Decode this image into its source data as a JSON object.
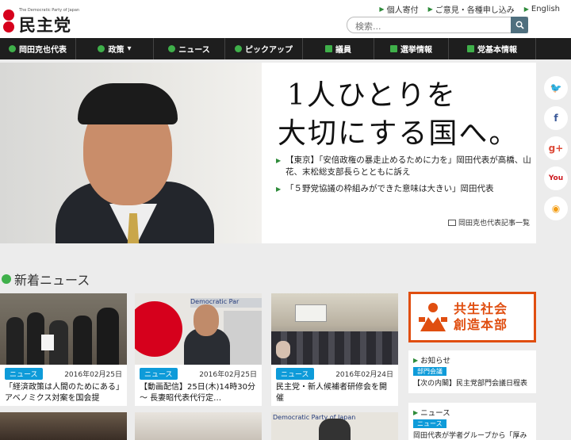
{
  "header": {
    "logo_sub": "The Democratic Party of Japan",
    "logo_name": "民主党",
    "links": [
      "個人寄付",
      "ご意見・各種申し込み",
      "English"
    ],
    "search_placeholder": "検索..."
  },
  "nav": {
    "items": [
      {
        "label": "岡田克也代表",
        "icon": "speech-icon"
      },
      {
        "label": "政策",
        "icon": "circle-icon",
        "dropdown": "▾"
      },
      {
        "label": "ニュース",
        "icon": "globe-icon"
      },
      {
        "label": "ピックアップ",
        "icon": "globe-icon"
      },
      {
        "label": "議員",
        "icon": "person-icon"
      },
      {
        "label": "選挙情報",
        "icon": "megaphone-icon"
      },
      {
        "label": "党基本情報",
        "icon": "briefcase-icon"
      }
    ]
  },
  "hero": {
    "copy_line1": "1人ひとりを",
    "copy_line2": "大切にする国へ。",
    "links": [
      "【東京】「安倍政権の暴走止めるために力を」岡田代表が高橋、山花、末松総支部長らとともに訴え",
      "「５野党協議の枠組みができた意味は大きい」岡田代表"
    ],
    "more_label": "岡田克也代表記事一覧"
  },
  "social": [
    "twitter-icon",
    "facebook-icon",
    "googleplus-icon",
    "youtube-icon",
    "rss-icon"
  ],
  "social_glyphs": [
    "🐦",
    "f",
    "g+",
    "You",
    "◉"
  ],
  "social_colors": [
    "#1da1f2",
    "#3b5998",
    "#dd4b39",
    "#cc181e",
    "#f39c12"
  ],
  "news": {
    "title": "新着ニュース",
    "cards": [
      {
        "badge": "ニュース",
        "date": "2016年02月25日",
        "title": "「経済政策は人間のためにある」アベノミクス対案を国会提"
      },
      {
        "badge": "ニュース",
        "date": "2016年02月25日",
        "title": "【動画配信】25日(木)14時30分～ 長妻昭代表代行定…"
      },
      {
        "badge": "ニュース",
        "date": "2016年02月24日",
        "title": "民主党・新人候補者研修会を開催"
      }
    ]
  },
  "sidebar": {
    "banner_line1": "共生社会",
    "banner_line2": "創造本部",
    "notices": [
      {
        "heading": "お知らせ",
        "badge": "部門会議",
        "text": "【次の内閣】民主党部門会議日程表"
      },
      {
        "heading": "ニュース",
        "badge": "ニュース",
        "text": "岡田代表が学者グループから「厚み"
      }
    ]
  }
}
